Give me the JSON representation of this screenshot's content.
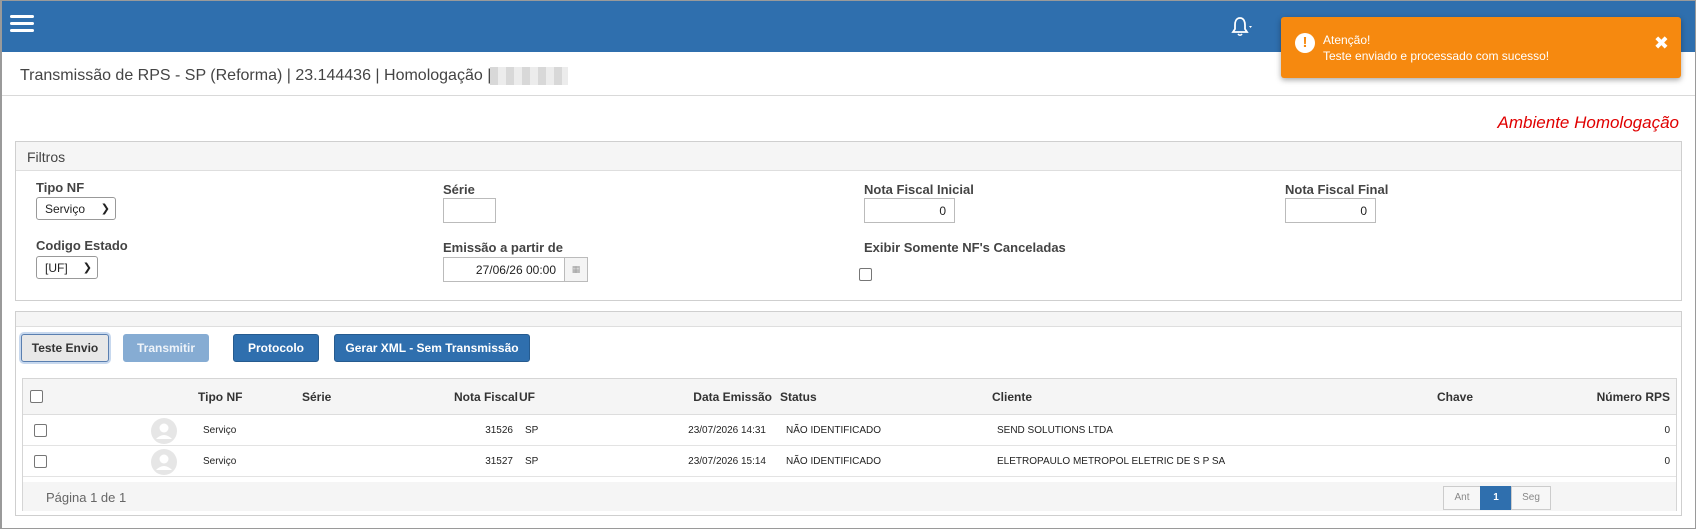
{
  "topbar": {
    "menu_icon": "hamburger-icon",
    "bell_icon": "bell-icon"
  },
  "toast": {
    "icon": "exclamation-icon",
    "icon_text": "!",
    "title": "Atenção!",
    "message": "Teste enviado e processado com sucesso!",
    "close": "✖"
  },
  "header": {
    "title": "Transmissão de RPS - SP (Reforma) | 23.144436 | Homologação |",
    "environment": "Ambiente Homologação"
  },
  "filters": {
    "panel_title": "Filtros",
    "tipo_nf": {
      "label": "Tipo NF",
      "value": "Serviço"
    },
    "serie": {
      "label": "Série",
      "value": ""
    },
    "nf_inicial": {
      "label": "Nota Fiscal Inicial",
      "value": "0"
    },
    "nf_final": {
      "label": "Nota Fiscal Final",
      "value": "0"
    },
    "codigo_estado": {
      "label": "Codigo Estado",
      "value": "[UF]"
    },
    "emissao": {
      "label": "Emissão a partir de",
      "value": "27/06/26 00:00",
      "calendar_icon": "calendar-icon"
    },
    "canceladas": {
      "label": "Exibir Somente NF's Canceladas"
    }
  },
  "actions": {
    "teste_envio": "Teste Envio",
    "transmitir": "Transmitir",
    "protocolo": "Protocolo",
    "gerar_xml": "Gerar XML - Sem Transmissão"
  },
  "table": {
    "columns": {
      "tipo_nf": "Tipo NF",
      "serie": "Série",
      "nota_fiscal": "Nota Fiscal",
      "uf": "UF",
      "data_emissao": "Data Emissão",
      "status": "Status",
      "cliente": "Cliente",
      "chave": "Chave",
      "numero_rps": "Número RPS"
    },
    "rows": [
      {
        "tipo_nf": "Serviço",
        "serie": "",
        "nota_fiscal": "31526",
        "uf": "SP",
        "data_emissao": "23/07/2026 14:31",
        "status": "NÃO IDENTIFICADO",
        "cliente": "SEND SOLUTIONS LTDA",
        "chave": "",
        "numero_rps": "0"
      },
      {
        "tipo_nf": "Serviço",
        "serie": "",
        "nota_fiscal": "31527",
        "uf": "SP",
        "data_emissao": "23/07/2026 15:14",
        "status": "NÃO IDENTIFICADO",
        "cliente": "ELETROPAULO METROPOL ELETRIC DE S P SA",
        "chave": "",
        "numero_rps": "0"
      }
    ],
    "pager": {
      "text": "Página 1 de 1",
      "prev": "Ant",
      "current": "1",
      "next": "Seg"
    }
  },
  "colors": {
    "brand": "#2f6fae",
    "warning": "#f6890f",
    "env_red": "#e00000"
  }
}
